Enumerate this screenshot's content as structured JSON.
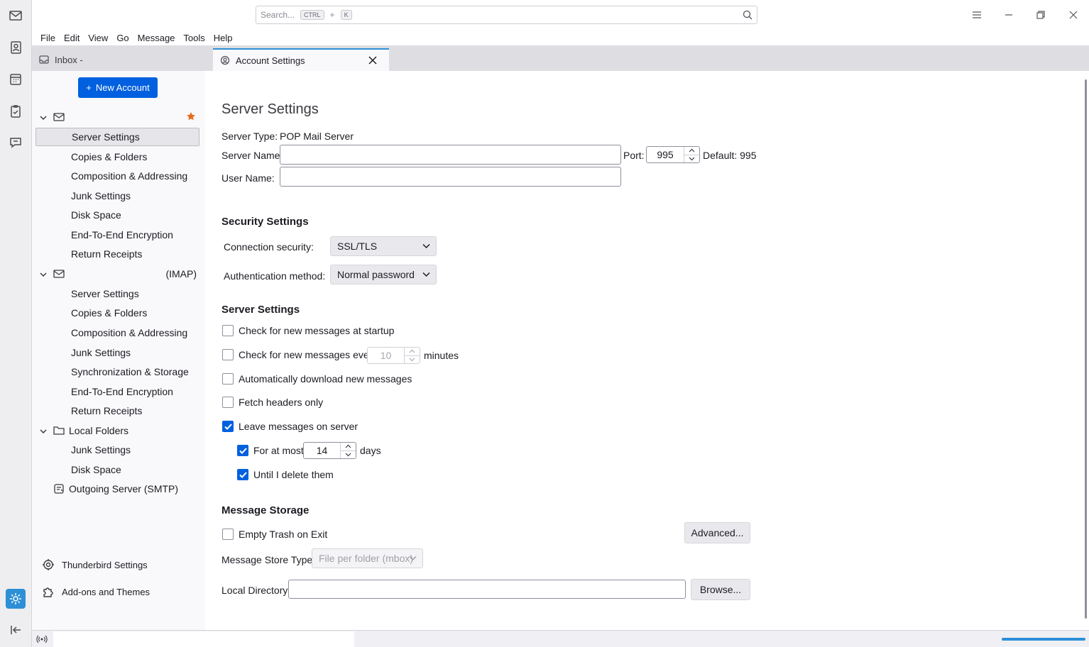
{
  "search": {
    "placeholder": "Search...",
    "key_mod": "CTRL",
    "key_plus": "+",
    "key": "K"
  },
  "menu": [
    "File",
    "Edit",
    "View",
    "Go",
    "Message",
    "Tools",
    "Help"
  ],
  "tabs": {
    "inbox": "Inbox - ",
    "account_settings": "Account Settings"
  },
  "sidebar": {
    "new_account": "New Account",
    "account1_items": [
      "Server Settings",
      "Copies & Folders",
      "Composition & Addressing",
      "Junk Settings",
      "Disk Space",
      "End-To-End Encryption",
      "Return Receipts"
    ],
    "account2_type": "(IMAP)",
    "account2_items": [
      "Server Settings",
      "Copies & Folders",
      "Composition & Addressing",
      "Junk Settings",
      "Synchronization & Storage",
      "End-To-End Encryption",
      "Return Receipts"
    ],
    "local_folders": "Local Folders",
    "local_items": [
      "Junk Settings",
      "Disk Space"
    ],
    "outgoing": "Outgoing Server (SMTP)",
    "thunderbird_settings": "Thunderbird Settings",
    "addons": "Add-ons and Themes"
  },
  "main": {
    "title": "Server Settings",
    "server_type_label": "Server Type:",
    "server_type_value": "POP Mail Server",
    "server_name_label": "Server Name:",
    "server_name_value": "",
    "port_label": "Port:",
    "port_value": "995",
    "default_label": "Default: 995",
    "user_name_label": "User Name:",
    "user_name_value": "",
    "security_heading": "Security Settings",
    "connection_security_label": "Connection security:",
    "connection_security_value": "SSL/TLS",
    "auth_label": "Authentication method:",
    "auth_value": "Normal password",
    "server_heading": "Server Settings",
    "check_startup": "Check for new messages at startup",
    "check_every": "Check for new messages every",
    "check_every_value": "10",
    "minutes": "minutes",
    "auto_download": "Automatically download new messages",
    "fetch_headers": "Fetch headers only",
    "leave_messages": "Leave messages on server",
    "for_at_most": "For at most",
    "days_value": "14",
    "days": "days",
    "until_delete": "Until I delete them",
    "storage_heading": "Message Storage",
    "empty_trash": "Empty Trash on Exit",
    "advanced": "Advanced...",
    "store_type_label": "Message Store Type:",
    "store_type_value": "File per folder (mbox)",
    "local_dir_label": "Local Directory:",
    "local_dir_value": "",
    "browse": "Browse..."
  },
  "checkboxes": {
    "check_startup": false,
    "check_every": false,
    "auto_download": false,
    "fetch_headers": false,
    "leave_messages": true,
    "for_at_most": true,
    "until_delete": true,
    "empty_trash": false
  },
  "icons": {
    "spaces": [
      "mail-icon",
      "address-book-icon",
      "calendar-icon",
      "tasks-icon",
      "chat-icon",
      "settings-icon",
      "collapse-icon"
    ]
  },
  "colors": {
    "accent": "#0060df",
    "spaces_active": "#2d8fd6",
    "star": "#e76a1a"
  }
}
